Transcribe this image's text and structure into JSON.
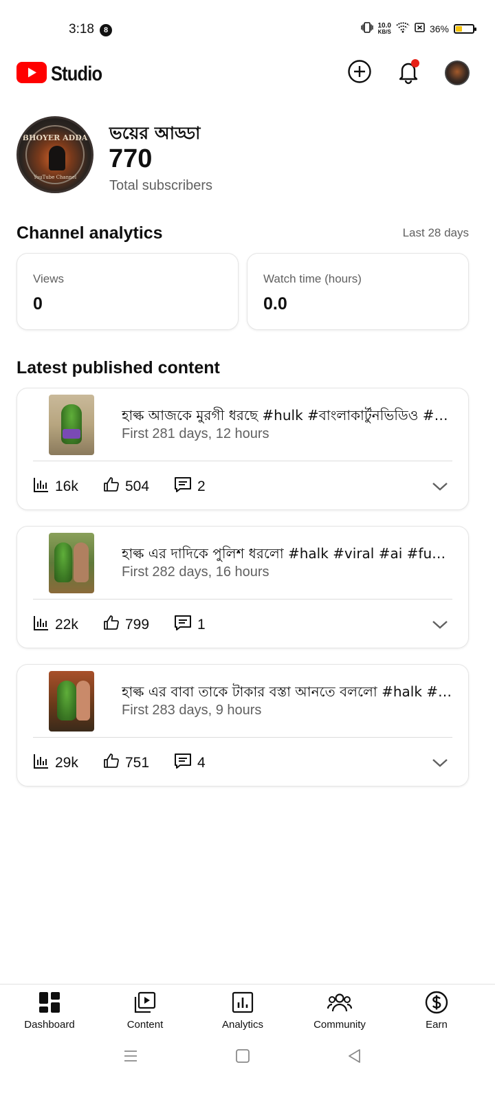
{
  "status_bar": {
    "time": "3:18",
    "notification_count": "8",
    "net_speed_value": "10.0",
    "net_speed_unit": "KB/S",
    "battery_percent": "36%",
    "battery_level": 0.36
  },
  "header": {
    "app_name": "Studio",
    "brand_color": "#ff0000",
    "notification_dot_color": "#e62117"
  },
  "channel": {
    "name": "ভয়ের আড্ডা",
    "subscriber_count": "770",
    "subscriber_label": "Total subscribers",
    "avatar_text": "BHOYER ADDA",
    "avatar_subtext": "YouTube Channel"
  },
  "analytics": {
    "title": "Channel analytics",
    "period": "Last 28 days",
    "cards": [
      {
        "label": "Views",
        "value": "0"
      },
      {
        "label": "Watch time (hours)",
        "value": "0.0"
      }
    ]
  },
  "latest": {
    "title": "Latest published content",
    "items": [
      {
        "title": "হাল্ক আজকে মুরগী ধরছে #hulk #বাংলাকার্টুনভিডিও #c...",
        "meta": "First 281 days, 12 hours",
        "views": "16k",
        "likes": "504",
        "comments": "2"
      },
      {
        "title": "হাল্ক এর দাদিকে পুলিশ ধরলো #halk #viral #ai #funny",
        "meta": "First 282 days, 16 hours",
        "views": "22k",
        "likes": "799",
        "comments": "1"
      },
      {
        "title": "হাল্ক এর বাবা তাকে টাকার বস্তা আনতে বললো #halk #vi...",
        "meta": "First 283 days, 9 hours",
        "views": "29k",
        "likes": "751",
        "comments": "4"
      }
    ]
  },
  "bottom_nav": {
    "items": [
      {
        "label": "Dashboard",
        "icon": "dashboard-icon"
      },
      {
        "label": "Content",
        "icon": "content-icon"
      },
      {
        "label": "Analytics",
        "icon": "analytics-icon"
      },
      {
        "label": "Community",
        "icon": "community-icon"
      },
      {
        "label": "Earn",
        "icon": "earn-icon"
      }
    ]
  },
  "system_nav": {
    "icons": [
      "recents-icon",
      "home-icon",
      "back-icon"
    ]
  }
}
